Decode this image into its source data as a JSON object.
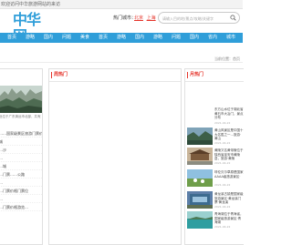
{
  "topbar": {
    "text": "欢迎访问中华旅游网站的来访"
  },
  "logo": {
    "text": "中华网",
    "subtitle": ""
  },
  "header": {
    "hot_label": "热门城市：",
    "hot_cities": [
      "北京",
      "上海",
      "厦门"
    ],
    "search_placeholder": "请输入目的地/景点/攻略/关键字"
  },
  "nav": {
    "items": [
      "首页",
      "游略",
      "国内",
      "问题",
      "美食",
      "首页",
      "游略",
      "国内",
      "游略",
      "问题",
      "国内",
      "省内",
      "城市"
    ]
  },
  "subnav": {
    "crumb": "当前位置：首页"
  },
  "columns": {
    "left": {
      "desc": "此位于广东清远市北部，共有近800个景区……",
      "list": [
        "……国家级景区旅游门票价格……",
        "城",
        "…沙",
        "…",
        "…城",
        "…门票……公路",
        "…",
        "…门票价格门票位",
        "…",
        "…门票价格游览…"
      ]
    },
    "mid": {
      "title": "周热门"
    },
    "right": {
      "title": "月热门",
      "items": [
        {
          "title": "东方山水位于湖北省黄石市大冶门，景点分布",
          "date": "2021-04-22"
        },
        {
          "title": "黄山风景区是中国十大名胜之一…旅游·黄山",
          "date": "2021-04-22"
        },
        {
          "title": "黄陵又名黄帝陵位于陕西省延安市黄陵县，旅游·黄陵",
          "date": "2021-04-22"
        },
        {
          "title": "呼伦贝尔草原是国家AAAA级旅游景区·",
          "date": "2021-04-22"
        },
        {
          "title": "黄龙溪古镇是国家级旅游景区·黄龙溪门票·黄龙溪",
          "date": "2021-04-22"
        },
        {
          "title": "青海湖位于青海省，国家级旅游景区·青海湖",
          "date": "2021-04-22"
        }
      ]
    }
  }
}
